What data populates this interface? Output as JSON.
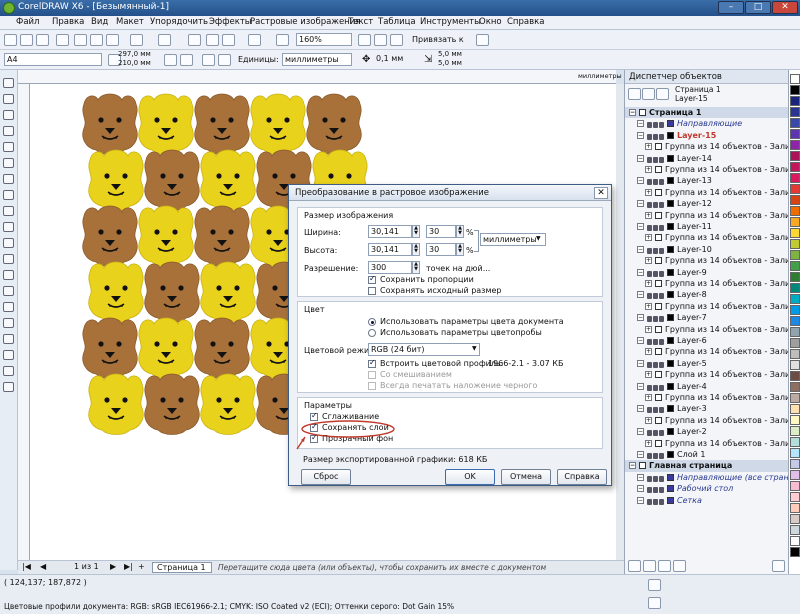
{
  "window": {
    "title": "CorelDRAW X6 - [Безымянный-1]",
    "buttons": [
      "–",
      "□",
      "✕"
    ]
  },
  "menu": [
    "Файл",
    "Правка",
    "Вид",
    "Макет",
    "Упорядочить",
    "Эффекты",
    "Растровые изображения",
    "Текст",
    "Таблица",
    "Инструменты",
    "Окно",
    "Справка"
  ],
  "toolbar": {
    "zoom": "160%",
    "snap": "Привязать к",
    "page_size": "A4",
    "width": "297,0 мм",
    "height": "210,0 мм",
    "units_label": "Единицы:",
    "units": "миллиметры",
    "nudge": "0,1 мм",
    "dup_x": "5,0 мм",
    "dup_y": "5,0 мм"
  },
  "ruler": {
    "unit": "миллиметры"
  },
  "dialog": {
    "title": "Преобразование в растровое изображение",
    "size_group": "Размер изображения",
    "width_label": "Ширина:",
    "width_value": "30,141",
    "width_pct": "30",
    "height_label": "Высота:",
    "height_value": "30,141",
    "height_pct": "30",
    "pct": "%",
    "units": "миллиметры",
    "resolution_label": "Разрешение:",
    "resolution_value": "300",
    "resolution_unit": "точек на дюй...",
    "keep_ratio": "Сохранить пропорции",
    "keep_original": "Сохранять исходный размер",
    "color_group": "Цвет",
    "use_doc_colors": "Использовать параметры цвета документа",
    "use_proof": "Использовать параметры цветопробы",
    "color_mode_label": "Цветовой режим:",
    "color_mode": "RGB (24 бит)",
    "embed_profile": "Встроить цветовой профиль:",
    "profile_value": "1966-2.1 - 3.07 КБ",
    "dithered": "Со смешиванием",
    "always_overprint": "Всегда печатать наложение черного",
    "params_group": "Параметры",
    "antialias": "Сглаживание",
    "keep_layers": "Сохранять слои",
    "transparent_bg": "Прозрачный фон",
    "export_size": "Размер экспортированной графики: 618 КБ",
    "reset": "Сброс",
    "ok": "OK",
    "cancel": "Отмена",
    "help": "Справка"
  },
  "object_manager": {
    "title": "Диспетчер объектов",
    "header_page": "Страница 1",
    "header_layer": "Layer-15",
    "rows": [
      {
        "t": "Страница 1",
        "lvl": 0,
        "kind": "page"
      },
      {
        "t": "Направляющие",
        "lvl": 1,
        "kind": "guides",
        "color": "#3a3aa0"
      },
      {
        "t": "Layer-15",
        "lvl": 1,
        "kind": "active",
        "color": "#000000"
      },
      {
        "t": "Группа из 14 объектов - Заливка",
        "lvl": 2,
        "kind": "group"
      },
      {
        "t": "Layer-14",
        "lvl": 1,
        "kind": "layer"
      },
      {
        "t": "Группа из 14 объектов - Заливка",
        "lvl": 2,
        "kind": "group"
      },
      {
        "t": "Layer-13",
        "lvl": 1,
        "kind": "layer"
      },
      {
        "t": "Группа из 14 объектов - Заливка",
        "lvl": 2,
        "kind": "group"
      },
      {
        "t": "Layer-12",
        "lvl": 1,
        "kind": "layer"
      },
      {
        "t": "Группа из 14 объектов - Заливка",
        "lvl": 2,
        "kind": "group"
      },
      {
        "t": "Layer-11",
        "lvl": 1,
        "kind": "layer"
      },
      {
        "t": "Группа из 14 объектов - Заливка",
        "lvl": 2,
        "kind": "group"
      },
      {
        "t": "Layer-10",
        "lvl": 1,
        "kind": "layer"
      },
      {
        "t": "Группа из 14 объектов - Заливка",
        "lvl": 2,
        "kind": "group"
      },
      {
        "t": "Layer-9",
        "lvl": 1,
        "kind": "layer"
      },
      {
        "t": "Группа из 14 объектов - Заливка",
        "lvl": 2,
        "kind": "group"
      },
      {
        "t": "Layer-8",
        "lvl": 1,
        "kind": "layer"
      },
      {
        "t": "Группа из 14 объектов - Заливка",
        "lvl": 2,
        "kind": "group"
      },
      {
        "t": "Layer-7",
        "lvl": 1,
        "kind": "layer"
      },
      {
        "t": "Группа из 14 объектов - Заливка",
        "lvl": 2,
        "kind": "group"
      },
      {
        "t": "Layer-6",
        "lvl": 1,
        "kind": "layer"
      },
      {
        "t": "Группа из 14 объектов - Заливка",
        "lvl": 2,
        "kind": "group"
      },
      {
        "t": "Layer-5",
        "lvl": 1,
        "kind": "layer"
      },
      {
        "t": "Группа из 14 объектов - Заливка",
        "lvl": 2,
        "kind": "group"
      },
      {
        "t": "Layer-4",
        "lvl": 1,
        "kind": "layer"
      },
      {
        "t": "Группа из 14 объектов - Заливка",
        "lvl": 2,
        "kind": "group"
      },
      {
        "t": "Layer-3",
        "lvl": 1,
        "kind": "layer"
      },
      {
        "t": "Группа из 14 объектов - Заливка",
        "lvl": 2,
        "kind": "group"
      },
      {
        "t": "Layer-2",
        "lvl": 1,
        "kind": "layer"
      },
      {
        "t": "Группа из 14 объектов - Заливка",
        "lvl": 2,
        "kind": "group"
      },
      {
        "t": "Слой 1",
        "lvl": 1,
        "kind": "layer"
      },
      {
        "t": "Главная страница",
        "lvl": 0,
        "kind": "page"
      },
      {
        "t": "Направляющие (все стран",
        "lvl": 1,
        "kind": "guides",
        "color": "#3a3aa0"
      },
      {
        "t": "Рабочий стол",
        "lvl": 1,
        "kind": "guides",
        "color": "#3a3aa0"
      },
      {
        "t": "Сетка",
        "lvl": 1,
        "kind": "guides",
        "color": "#3a3aa0"
      }
    ]
  },
  "pager": {
    "counter": "1 из 1",
    "tab": "Страница 1",
    "hint": "Перетащите сюда цвета (или объекты), чтобы сохранить их вместе с документом"
  },
  "status": {
    "coords": "( 124,137; 187,872 )",
    "profiles": "Цветовые профили документа: RGB: sRGB IEC61966-2.1; CMYK: ISO Coated v2 (ECI); Оттенки серого: Dot Gain 15%"
  },
  "colors": {
    "brown": "#a8713a",
    "yellow": "#e9d21c",
    "annotation": "#c0392b"
  },
  "palette": [
    "#ffffff",
    "#000000",
    "#1a237e",
    "#283593",
    "#3949ab",
    "#5e35b1",
    "#8e24aa",
    "#ad1457",
    "#c2185b",
    "#d81b60",
    "#e53935",
    "#d84315",
    "#ef6c00",
    "#f9a825",
    "#fdd835",
    "#c0ca33",
    "#7cb342",
    "#43a047",
    "#2e7d32",
    "#00897b",
    "#00acc1",
    "#039be5",
    "#1e88e5",
    "#90a4ae",
    "#9e9e9e",
    "#bdbdbd",
    "#e0e0e0",
    "#6d4c41",
    "#8d6e63",
    "#bcaaa4",
    "#ffe0b2",
    "#fff9c4",
    "#dcedc8",
    "#b2dfdb",
    "#b3e5fc",
    "#c5cae9",
    "#e1bee7",
    "#f8bbd0",
    "#ffcdd2",
    "#ffccbc",
    "#d7ccc8",
    "#cfd8dc",
    "#ffffff",
    "#000000"
  ]
}
